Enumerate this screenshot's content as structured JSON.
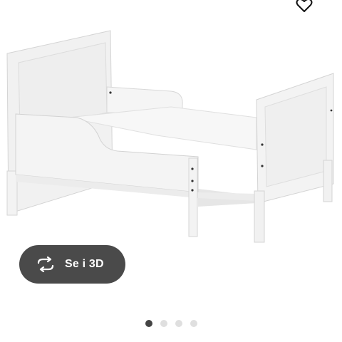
{
  "product": {
    "image_icon": "extendable-bed-frame-white",
    "favorite_icon": "heart-icon"
  },
  "view_3d": {
    "label": "Se i 3D",
    "icon": "rotate-3d-icon",
    "background_color": "#4a4a4a"
  },
  "carousel": {
    "slide_count": 4,
    "active_index": 0,
    "active_color": "#444444",
    "inactive_color": "#dfdfdf"
  }
}
